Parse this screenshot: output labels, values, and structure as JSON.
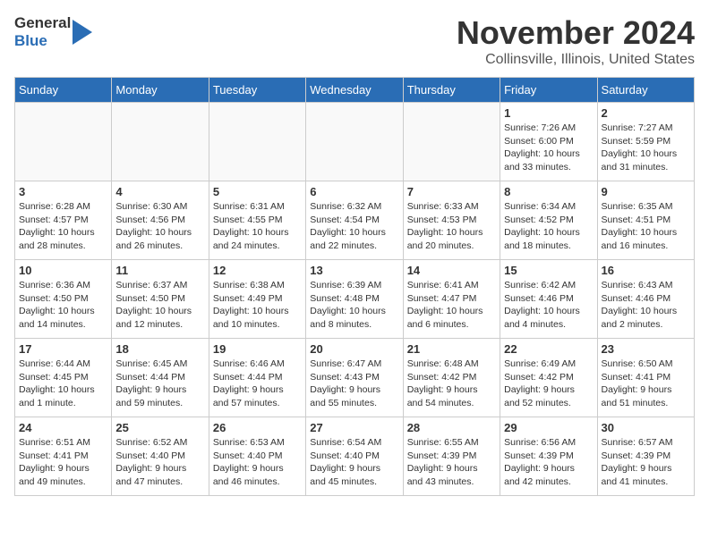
{
  "logo": {
    "line1": "General",
    "line2": "Blue"
  },
  "title": "November 2024",
  "location": "Collinsville, Illinois, United States",
  "days_of_week": [
    "Sunday",
    "Monday",
    "Tuesday",
    "Wednesday",
    "Thursday",
    "Friday",
    "Saturday"
  ],
  "weeks": [
    [
      {
        "day": "",
        "info": ""
      },
      {
        "day": "",
        "info": ""
      },
      {
        "day": "",
        "info": ""
      },
      {
        "day": "",
        "info": ""
      },
      {
        "day": "",
        "info": ""
      },
      {
        "day": "1",
        "info": "Sunrise: 7:26 AM\nSunset: 6:00 PM\nDaylight: 10 hours\nand 33 minutes."
      },
      {
        "day": "2",
        "info": "Sunrise: 7:27 AM\nSunset: 5:59 PM\nDaylight: 10 hours\nand 31 minutes."
      }
    ],
    [
      {
        "day": "3",
        "info": "Sunrise: 6:28 AM\nSunset: 4:57 PM\nDaylight: 10 hours\nand 28 minutes."
      },
      {
        "day": "4",
        "info": "Sunrise: 6:30 AM\nSunset: 4:56 PM\nDaylight: 10 hours\nand 26 minutes."
      },
      {
        "day": "5",
        "info": "Sunrise: 6:31 AM\nSunset: 4:55 PM\nDaylight: 10 hours\nand 24 minutes."
      },
      {
        "day": "6",
        "info": "Sunrise: 6:32 AM\nSunset: 4:54 PM\nDaylight: 10 hours\nand 22 minutes."
      },
      {
        "day": "7",
        "info": "Sunrise: 6:33 AM\nSunset: 4:53 PM\nDaylight: 10 hours\nand 20 minutes."
      },
      {
        "day": "8",
        "info": "Sunrise: 6:34 AM\nSunset: 4:52 PM\nDaylight: 10 hours\nand 18 minutes."
      },
      {
        "day": "9",
        "info": "Sunrise: 6:35 AM\nSunset: 4:51 PM\nDaylight: 10 hours\nand 16 minutes."
      }
    ],
    [
      {
        "day": "10",
        "info": "Sunrise: 6:36 AM\nSunset: 4:50 PM\nDaylight: 10 hours\nand 14 minutes."
      },
      {
        "day": "11",
        "info": "Sunrise: 6:37 AM\nSunset: 4:50 PM\nDaylight: 10 hours\nand 12 minutes."
      },
      {
        "day": "12",
        "info": "Sunrise: 6:38 AM\nSunset: 4:49 PM\nDaylight: 10 hours\nand 10 minutes."
      },
      {
        "day": "13",
        "info": "Sunrise: 6:39 AM\nSunset: 4:48 PM\nDaylight: 10 hours\nand 8 minutes."
      },
      {
        "day": "14",
        "info": "Sunrise: 6:41 AM\nSunset: 4:47 PM\nDaylight: 10 hours\nand 6 minutes."
      },
      {
        "day": "15",
        "info": "Sunrise: 6:42 AM\nSunset: 4:46 PM\nDaylight: 10 hours\nand 4 minutes."
      },
      {
        "day": "16",
        "info": "Sunrise: 6:43 AM\nSunset: 4:46 PM\nDaylight: 10 hours\nand 2 minutes."
      }
    ],
    [
      {
        "day": "17",
        "info": "Sunrise: 6:44 AM\nSunset: 4:45 PM\nDaylight: 10 hours\nand 1 minute."
      },
      {
        "day": "18",
        "info": "Sunrise: 6:45 AM\nSunset: 4:44 PM\nDaylight: 9 hours\nand 59 minutes."
      },
      {
        "day": "19",
        "info": "Sunrise: 6:46 AM\nSunset: 4:44 PM\nDaylight: 9 hours\nand 57 minutes."
      },
      {
        "day": "20",
        "info": "Sunrise: 6:47 AM\nSunset: 4:43 PM\nDaylight: 9 hours\nand 55 minutes."
      },
      {
        "day": "21",
        "info": "Sunrise: 6:48 AM\nSunset: 4:42 PM\nDaylight: 9 hours\nand 54 minutes."
      },
      {
        "day": "22",
        "info": "Sunrise: 6:49 AM\nSunset: 4:42 PM\nDaylight: 9 hours\nand 52 minutes."
      },
      {
        "day": "23",
        "info": "Sunrise: 6:50 AM\nSunset: 4:41 PM\nDaylight: 9 hours\nand 51 minutes."
      }
    ],
    [
      {
        "day": "24",
        "info": "Sunrise: 6:51 AM\nSunset: 4:41 PM\nDaylight: 9 hours\nand 49 minutes."
      },
      {
        "day": "25",
        "info": "Sunrise: 6:52 AM\nSunset: 4:40 PM\nDaylight: 9 hours\nand 47 minutes."
      },
      {
        "day": "26",
        "info": "Sunrise: 6:53 AM\nSunset: 4:40 PM\nDaylight: 9 hours\nand 46 minutes."
      },
      {
        "day": "27",
        "info": "Sunrise: 6:54 AM\nSunset: 4:40 PM\nDaylight: 9 hours\nand 45 minutes."
      },
      {
        "day": "28",
        "info": "Sunrise: 6:55 AM\nSunset: 4:39 PM\nDaylight: 9 hours\nand 43 minutes."
      },
      {
        "day": "29",
        "info": "Sunrise: 6:56 AM\nSunset: 4:39 PM\nDaylight: 9 hours\nand 42 minutes."
      },
      {
        "day": "30",
        "info": "Sunrise: 6:57 AM\nSunset: 4:39 PM\nDaylight: 9 hours\nand 41 minutes."
      }
    ]
  ]
}
